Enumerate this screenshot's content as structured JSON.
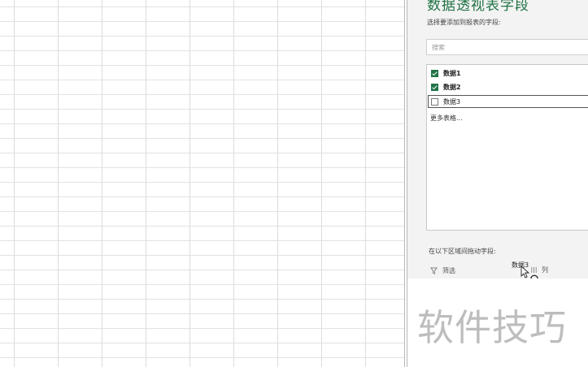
{
  "spreadsheet": {},
  "pivot_pane": {
    "title": "数据透视表字段",
    "subtitle": "选择要添加到报表的字段:",
    "search_placeholder": "搜索",
    "fields": [
      {
        "label": "数据1",
        "checked": true
      },
      {
        "label": "数据2",
        "checked": true
      },
      {
        "label": "数据3",
        "checked": false
      }
    ],
    "more_tables": "更多表格...",
    "drag_hint": "在以下区域间拖动字段:",
    "filter_label": "筛选",
    "column_label": "列",
    "dragging_field": "数据3"
  },
  "watermark": "软件技巧",
  "colors": {
    "accent": "#217346"
  }
}
